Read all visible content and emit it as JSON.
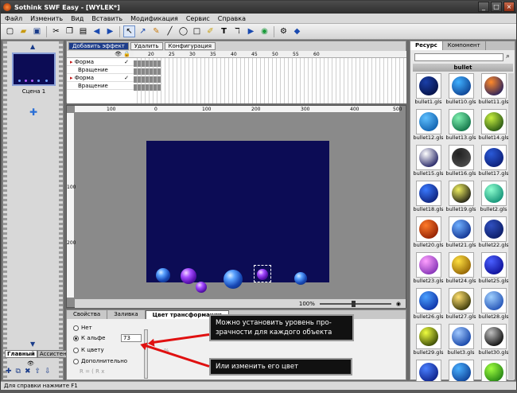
{
  "window": {
    "title": "Sothink SWF Easy - [WYLEK*]"
  },
  "menu": [
    "Файл",
    "Изменить",
    "Вид",
    "Вставить",
    "Модификация",
    "Сервис",
    "Справка"
  ],
  "toolbar_icons": [
    "new-icon",
    "open-icon",
    "save-icon",
    "cut-icon",
    "copy-icon",
    "paste-icon",
    "undo-icon",
    "redo-icon",
    "select-arrow-icon",
    "subselect-icon",
    "pencil-icon",
    "line-icon",
    "ellipse-icon",
    "rectangle-icon",
    "brush-icon",
    "text-icon",
    "pen-icon",
    "button-icon",
    "internet-icon",
    "preview-icon",
    "publish-icon"
  ],
  "scene": {
    "label": "Сцена 1"
  },
  "left_tabs": [
    "Главный",
    "Ассистент"
  ],
  "timeline": {
    "add_effect": "Добавить эффект",
    "delete": "Удалить",
    "config": "Конфигурация",
    "ruler": [
      "20",
      "25",
      "30",
      "35",
      "40",
      "45",
      "50",
      "55",
      "60"
    ],
    "layers": [
      {
        "name": "Форма",
        "sub": false
      },
      {
        "name": "Вращение",
        "sub": true
      },
      {
        "name": "Форма",
        "sub": false
      },
      {
        "name": "Вращение",
        "sub": true
      }
    ]
  },
  "stage": {
    "hruler": [
      "100",
      "0",
      "100",
      "200",
      "300",
      "400",
      "500"
    ],
    "vruler": [
      "100",
      "200"
    ],
    "zoom": "100%"
  },
  "props": {
    "tabs": [
      "Свойства",
      "Заливка",
      "Цвет трансформации"
    ],
    "options": {
      "none": "Нет",
      "alpha": "К альфе",
      "color": "К цвету",
      "advanced": "Дополнительно"
    },
    "alpha_value": "73",
    "percent": "%",
    "r_line": "R = ( R x"
  },
  "callouts": {
    "top": "Можно установить уровень про-\nзрачности для каждого объекта",
    "bottom": "Или изменить его цвет"
  },
  "resources": {
    "tabs": [
      "Ресурс",
      "Компонент"
    ],
    "folder": "bullet",
    "items": [
      {
        "label": "bullet1.gls",
        "c1": "#1a3fa8",
        "c2": "#050f40"
      },
      {
        "label": "bullet10.gls",
        "c1": "#3fb0ff",
        "c2": "#0a3a8a"
      },
      {
        "label": "bullet11.gls",
        "c1": "#ff8a2a",
        "c2": "#1a1a60"
      },
      {
        "label": "bullet12.gls",
        "c1": "#5fc0ff",
        "c2": "#0a5aa8"
      },
      {
        "label": "bullet13.gls",
        "c1": "#7ff0b0",
        "c2": "#0a6a40"
      },
      {
        "label": "bullet14.gls",
        "c1": "#c8f040",
        "c2": "#1a4a10"
      },
      {
        "label": "bullet15.gls",
        "c1": "#ffffff",
        "c2": "#14145a"
      },
      {
        "label": "bullet16.gls",
        "c1": "#202020",
        "c2": "#505050"
      },
      {
        "label": "bullet17.gls",
        "c1": "#2a5ad8",
        "c2": "#0a1a70"
      },
      {
        "label": "bullet18.gls",
        "c1": "#3a7aff",
        "c2": "#0a1a70"
      },
      {
        "label": "bullet19.gls",
        "c1": "#f0f060",
        "c2": "#101010"
      },
      {
        "label": "bullet2.gls",
        "c1": "#8fffd0",
        "c2": "#0a8a70"
      },
      {
        "label": "bullet20.gls",
        "c1": "#ff7a2a",
        "c2": "#8a1a00"
      },
      {
        "label": "bullet21.gls",
        "c1": "#70b0ff",
        "c2": "#0a2a8a"
      },
      {
        "label": "bullet22.gls",
        "c1": "#3050c0",
        "c2": "#0a1a60"
      },
      {
        "label": "bullet23.gls",
        "c1": "#ffa0ff",
        "c2": "#7a2ab0"
      },
      {
        "label": "bullet24.gls",
        "c1": "#ffe040",
        "c2": "#8a5a00"
      },
      {
        "label": "bullet25.gls",
        "c1": "#4a60ff",
        "c2": "#0a0a90"
      },
      {
        "label": "bullet26.gls",
        "c1": "#4aa0ff",
        "c2": "#0a2aa0"
      },
      {
        "label": "bullet27.gls",
        "c1": "#ffe070",
        "c2": "#2a2a00"
      },
      {
        "label": "bullet28.gls",
        "c1": "#a0d0ff",
        "c2": "#1a4ab0"
      },
      {
        "label": "bullet29.gls",
        "c1": "#f0ff40",
        "c2": "#2a3a00"
      },
      {
        "label": "bullet3.gls",
        "c1": "#a0c8ff",
        "c2": "#0a3aa0"
      },
      {
        "label": "bullet30.gls",
        "c1": "#c0c0c0",
        "c2": "#000000"
      },
      {
        "label": "",
        "c1": "#4a80ff",
        "c2": "#0a1a80"
      },
      {
        "label": "",
        "c1": "#4ab0ff",
        "c2": "#0a3a90"
      },
      {
        "label": "",
        "c1": "#a0ff40",
        "c2": "#1a7a10"
      }
    ]
  },
  "statusbar": "Для справки нажмите F1"
}
